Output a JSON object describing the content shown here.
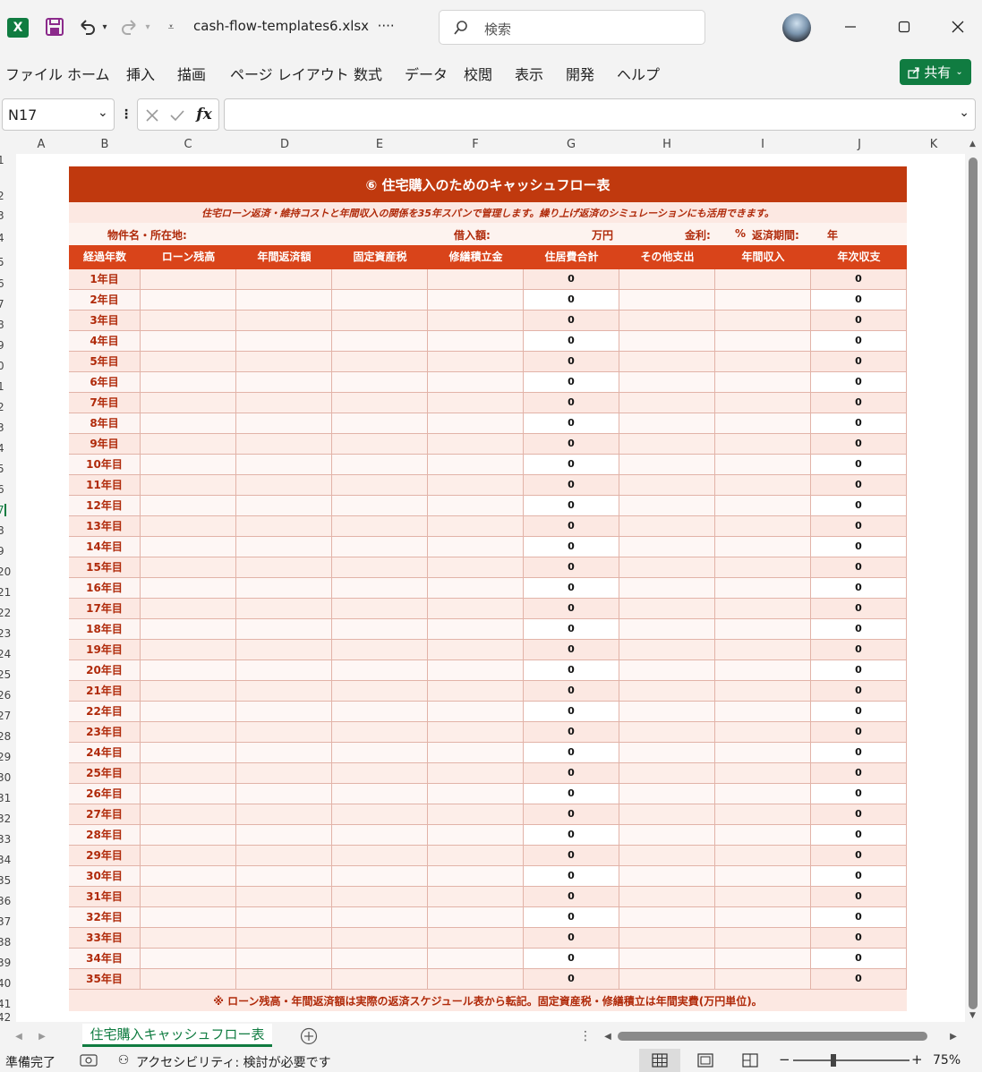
{
  "window": {
    "file_name": "cash-flow-templates6.xlsx",
    "more": "····",
    "search_placeholder": "検索"
  },
  "ribbon": {
    "tabs": [
      "ファイル",
      "ホーム",
      "挿入",
      "描画",
      "ページ レイアウト",
      "数式",
      "データ",
      "校閲",
      "表示",
      "開発",
      "ヘルプ"
    ],
    "share_label": "共有"
  },
  "formula_bar": {
    "name_box": "N17",
    "fx": "fx",
    "value": ""
  },
  "columns": [
    "A",
    "B",
    "C",
    "D",
    "E",
    "F",
    "G",
    "H",
    "I",
    "J",
    "K"
  ],
  "row_numbers": [
    "1",
    "2",
    "3",
    "4",
    "5",
    "6",
    "7",
    "8",
    "9",
    "0",
    "1",
    "2",
    "3",
    "4",
    "5",
    "6",
    "7",
    "8",
    "9",
    "20",
    "21",
    "22",
    "23",
    "24",
    "25",
    "26",
    "27",
    "28",
    "29",
    "30",
    "31",
    "32",
    "33",
    "34",
    "35",
    "36",
    "37",
    "38",
    "39",
    "40",
    "41",
    "42"
  ],
  "sheet": {
    "title": "⑥ 住宅購入のためのキャッシュフロー表",
    "subtitle": "住宅ローン返済・維持コストと年間収入の関係を35年スパンで管理します。繰り上げ返済のシミュレーションにも活用できます。",
    "info": {
      "property_label": "物件名・所在地:",
      "loan_label": "借入額:",
      "loan_unit": "万円",
      "rate_label": "金利:",
      "rate_unit": "%",
      "term_label": "返済期間:",
      "term_unit": "年"
    },
    "headers": [
      "経過年数",
      "ローン残高",
      "年間返済額",
      "固定資産税",
      "修繕積立金",
      "住居費合計",
      "その他支出",
      "年間収入",
      "年次収支"
    ],
    "rows": [
      {
        "year": "1年目",
        "housing_total": "0",
        "annual_balance": "0"
      },
      {
        "year": "2年目",
        "housing_total": "0",
        "annual_balance": "0"
      },
      {
        "year": "3年目",
        "housing_total": "0",
        "annual_balance": "0"
      },
      {
        "year": "4年目",
        "housing_total": "0",
        "annual_balance": "0"
      },
      {
        "year": "5年目",
        "housing_total": "0",
        "annual_balance": "0"
      },
      {
        "year": "6年目",
        "housing_total": "0",
        "annual_balance": "0"
      },
      {
        "year": "7年目",
        "housing_total": "0",
        "annual_balance": "0"
      },
      {
        "year": "8年目",
        "housing_total": "0",
        "annual_balance": "0"
      },
      {
        "year": "9年目",
        "housing_total": "0",
        "annual_balance": "0"
      },
      {
        "year": "10年目",
        "housing_total": "0",
        "annual_balance": "0"
      },
      {
        "year": "11年目",
        "housing_total": "0",
        "annual_balance": "0"
      },
      {
        "year": "12年目",
        "housing_total": "0",
        "annual_balance": "0"
      },
      {
        "year": "13年目",
        "housing_total": "0",
        "annual_balance": "0"
      },
      {
        "year": "14年目",
        "housing_total": "0",
        "annual_balance": "0"
      },
      {
        "year": "15年目",
        "housing_total": "0",
        "annual_balance": "0"
      },
      {
        "year": "16年目",
        "housing_total": "0",
        "annual_balance": "0"
      },
      {
        "year": "17年目",
        "housing_total": "0",
        "annual_balance": "0"
      },
      {
        "year": "18年目",
        "housing_total": "0",
        "annual_balance": "0"
      },
      {
        "year": "19年目",
        "housing_total": "0",
        "annual_balance": "0"
      },
      {
        "year": "20年目",
        "housing_total": "0",
        "annual_balance": "0"
      },
      {
        "year": "21年目",
        "housing_total": "0",
        "annual_balance": "0"
      },
      {
        "year": "22年目",
        "housing_total": "0",
        "annual_balance": "0"
      },
      {
        "year": "23年目",
        "housing_total": "0",
        "annual_balance": "0"
      },
      {
        "year": "24年目",
        "housing_total": "0",
        "annual_balance": "0"
      },
      {
        "year": "25年目",
        "housing_total": "0",
        "annual_balance": "0"
      },
      {
        "year": "26年目",
        "housing_total": "0",
        "annual_balance": "0"
      },
      {
        "year": "27年目",
        "housing_total": "0",
        "annual_balance": "0"
      },
      {
        "year": "28年目",
        "housing_total": "0",
        "annual_balance": "0"
      },
      {
        "year": "29年目",
        "housing_total": "0",
        "annual_balance": "0"
      },
      {
        "year": "30年目",
        "housing_total": "0",
        "annual_balance": "0"
      },
      {
        "year": "31年目",
        "housing_total": "0",
        "annual_balance": "0"
      },
      {
        "year": "32年目",
        "housing_total": "0",
        "annual_balance": "0"
      },
      {
        "year": "33年目",
        "housing_total": "0",
        "annual_balance": "0"
      },
      {
        "year": "34年目",
        "housing_total": "0",
        "annual_balance": "0"
      },
      {
        "year": "35年目",
        "housing_total": "0",
        "annual_balance": "0"
      }
    ],
    "footnote": "※ ローン残高・年間返済額は実際の返済スケジュール表から転記。固定資産税・修繕積立は年間実費(万円単位)。"
  },
  "tabs": {
    "active_sheet": "住宅購入キャッシュフロー表"
  },
  "status": {
    "ready": "準備完了",
    "accessibility": "アクセシビリティ: 検討が必要です",
    "zoom_minus": "−",
    "zoom_plus": "+",
    "zoom": "75%"
  },
  "colors": {
    "accent": "#107c41",
    "banner": "#c0390e",
    "header": "#d9441a",
    "label_red": "#b02a0a",
    "row_pink": "#fce8e2"
  }
}
